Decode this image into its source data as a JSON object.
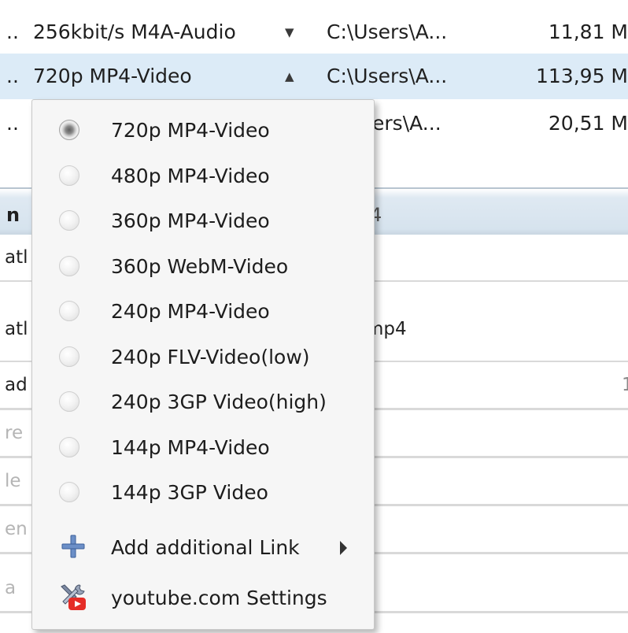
{
  "downloads": [
    {
      "prefix": "..",
      "format": "256kbit/s M4A-Audio",
      "arrow": "▼",
      "path": "C:\\Users\\A...",
      "size": "11,81 M"
    },
    {
      "prefix": "..",
      "format": "720p MP4-Video",
      "arrow": "▲",
      "path": "C:\\Users\\A...",
      "size": "113,95 M"
    },
    {
      "prefix": "..",
      "format": "",
      "arrow": "",
      "path": "sers\\A...",
      "size": "20,51 M"
    }
  ],
  "properties": {
    "section_title": "n",
    "section_value": "4",
    "rows": [
      {
        "key": "atl",
        "value": ""
      },
      {
        "key": "atl",
        "value": "mp4"
      },
      {
        "key": "ad",
        "value": "",
        "value2": "1"
      },
      {
        "key": "re",
        "value": ""
      },
      {
        "key": "le",
        "value": ""
      },
      {
        "key": "en",
        "value": ""
      },
      {
        "key": "a",
        "value": ""
      }
    ]
  },
  "menu": {
    "formats": [
      {
        "label": "720p MP4-Video",
        "checked": true
      },
      {
        "label": "480p MP4-Video",
        "checked": false
      },
      {
        "label": "360p MP4-Video",
        "checked": false
      },
      {
        "label": "360p WebM-Video",
        "checked": false
      },
      {
        "label": "240p MP4-Video",
        "checked": false
      },
      {
        "label": "240p FLV-Video(low)",
        "checked": false
      },
      {
        "label": "240p 3GP Video(high)",
        "checked": false
      },
      {
        "label": "144p MP4-Video",
        "checked": false
      },
      {
        "label": "144p 3GP Video",
        "checked": false
      }
    ],
    "add_link_label": "Add additional Link",
    "settings_label": "youtube.com Settings",
    "icons": {
      "add": "plus-icon",
      "settings": "tools-youtube-icon"
    }
  },
  "colors": {
    "selected_row": "#dcebf7",
    "youtube_red": "#e52d27"
  }
}
